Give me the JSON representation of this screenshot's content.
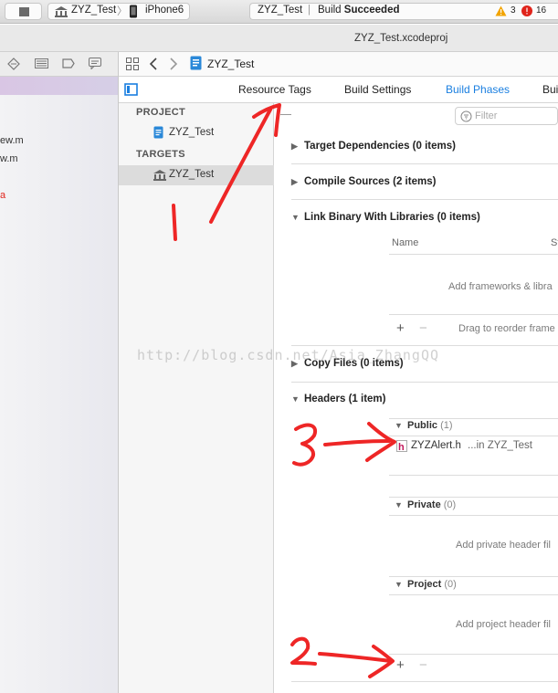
{
  "toolbar": {
    "scheme": "ZYZ_Test",
    "device": "iPhone6",
    "status_project": "ZYZ_Test",
    "status_separator": "|",
    "status_prefix": "Build ",
    "status_result": "Succeeded",
    "warnings_count": "3",
    "errors_count": "16"
  },
  "window": {
    "title": "ZYZ_Test.xcodeproj"
  },
  "navigator": {
    "files": [
      "ew.m",
      "w.m",
      "a"
    ]
  },
  "jumpbar": {
    "project": "ZYZ_Test"
  },
  "tabs": [
    "Resource Tags",
    "Build Settings",
    "Build Phases",
    "Bui"
  ],
  "active_tab": "Build Phases",
  "list": {
    "project_header": "PROJECT",
    "project_item": "ZYZ_Test",
    "targets_header": "TARGETS",
    "target_item": "ZYZ_Test"
  },
  "filter": {
    "placeholder": "Filter"
  },
  "phases": {
    "target_dependencies": "Target Dependencies (0 items)",
    "compile_sources": "Compile Sources (2 items)",
    "link_binary": "Link Binary With Libraries (0 items)",
    "link_col_name": "Name",
    "link_col_status": "St",
    "link_add_hint": "Add frameworks & libra",
    "link_drag_hint": "Drag to reorder frame",
    "copy_files": "Copy Files (0 items)",
    "headers": "Headers (1 item)",
    "public_label": "Public",
    "public_count": "(1)",
    "header_file": "ZYZAlert.h",
    "header_location": "...in ZYZ_Test",
    "private_label": "Private",
    "private_count": "(0)",
    "private_hint": "Add private header fil",
    "project_label": "Project",
    "project_count": "(0)",
    "project_hint": "Add project header fil"
  },
  "controls": {
    "plus": "+",
    "minus": "−"
  },
  "annotations": {
    "mark_1": "1",
    "mark_2": "2",
    "mark_3": "3"
  },
  "watermark": "http://blog.csdn.net/Asia_ZhangQQ",
  "colors": {
    "accent": "#1a7fe0",
    "annotation": "#ee2626",
    "error": "#e0241b",
    "warning": "#f2a400"
  }
}
